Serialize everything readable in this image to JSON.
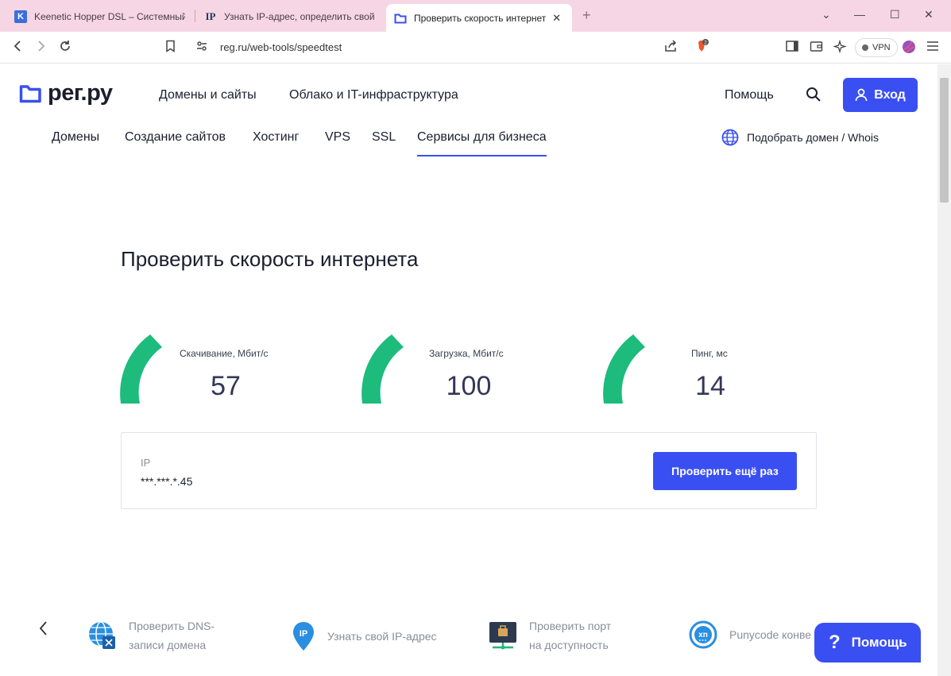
{
  "browser": {
    "tabs": [
      {
        "title": "Keenetic Hopper DSL – Системный",
        "favicon": "K"
      },
      {
        "title": "Узнать IP-адрес, определить свой",
        "favicon": "IP"
      },
      {
        "title": "Проверить скорость интернет",
        "favicon": "folder"
      }
    ],
    "address": "reg.ru/web-tools/speedtest",
    "vpn_label": "VPN",
    "badge_count": "2"
  },
  "header": {
    "logo": "рег.ру",
    "nav": [
      "Домены и сайты",
      "Облако и IT-инфраструктура"
    ],
    "help": "Помощь",
    "login": "Вход"
  },
  "subnav": {
    "items": [
      "Домены",
      "Создание сайтов",
      "Хостинг",
      "VPS",
      "SSL",
      "Сервисы для бизнеса"
    ],
    "whois": "Подобрать домен / Whois"
  },
  "main": {
    "title": "Проверить скорость интернета",
    "metrics": [
      {
        "label": "Скачивание, Мбит/с",
        "value": "57"
      },
      {
        "label": "Загрузка, Мбит/с",
        "value": "100"
      },
      {
        "label": "Пинг, мс",
        "value": "14"
      }
    ],
    "ip_label": "IP",
    "ip_value": "***.***.*.45",
    "retry": "Проверить ещё раз"
  },
  "tools": [
    {
      "line1": "Проверить DNS-",
      "line2": "записи домена",
      "icon": "dns-globe-icon"
    },
    {
      "line1": "Узнать свой IP-адрес",
      "line2": "",
      "icon": "ip-pin-icon"
    },
    {
      "line1": "Проверить порт",
      "line2": "на доступность",
      "icon": "port-server-icon"
    },
    {
      "line1": "Punycode конве",
      "line2": "",
      "icon": "punycode-icon"
    }
  ],
  "help_widget": {
    "label": "Помощь"
  },
  "colors": {
    "accent": "#3a4ff2",
    "gauge": "#1dbb7c",
    "tabbar": "#f6d6e4"
  }
}
